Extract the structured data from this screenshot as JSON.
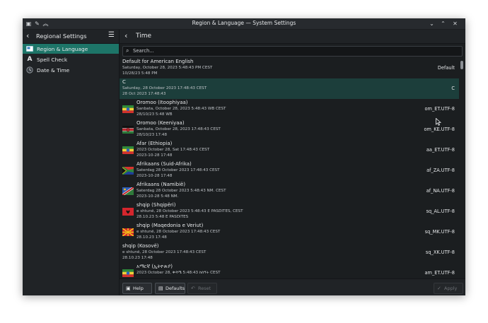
{
  "window": {
    "title": "Region & Language — System Settings"
  },
  "sidebar": {
    "header": "Regional Settings",
    "items": [
      {
        "label": "Region & Language",
        "icon": "region-icon",
        "active": true
      },
      {
        "label": "Spell Check",
        "icon": "spellcheck-icon",
        "active": false
      },
      {
        "label": "Date & Time",
        "icon": "clock-icon",
        "active": false
      }
    ]
  },
  "main": {
    "header": "Time",
    "search_placeholder": "Search...",
    "rows": [
      {
        "name": "Default for American English",
        "line2": "Saturday, October 28, 2023 5:48:43 PM CEST",
        "line3": "10/28/23 5:48 PM",
        "code": "Default",
        "flag": "none"
      },
      {
        "name": "C",
        "line2": "Saturday, 28 October 2023 17:48:43 CEST",
        "line3": "28 Oct 2023 17:48:43",
        "code": "C",
        "flag": "none",
        "selected": true
      },
      {
        "name": "Oromoo (Itoophiyaa)",
        "line2": "Sanbata, October 28, 2023 5:48:43 WB CEST",
        "line3": "28/10/23 5:48 WB",
        "code": "om_ET.UTF-8",
        "flag": "ethiopia"
      },
      {
        "name": "Oromoo (Keeniyaa)",
        "line2": "Sanbata, October 28, 2023 17:48:43 CEST",
        "line3": "28/10/23 17:48",
        "code": "om_KE.UTF-8",
        "flag": "kenya"
      },
      {
        "name": "Afar (Ethiopia)",
        "line2": "2023 October 28, Sat 17:48:43 CEST",
        "line3": "2023-10-28 17:48",
        "code": "aa_ET.UTF-8",
        "flag": "ethiopia"
      },
      {
        "name": "Afrikaans (Suid-Afrika)",
        "line2": "Saterdag 28 October 2023 17:48:43 CEST",
        "line3": "2023-10-28 17:48",
        "code": "af_ZA.UTF-8",
        "flag": "southafrica"
      },
      {
        "name": "Afrikaans (Namibië)",
        "line2": "Saterdag 28 October 2023 5:48:43 NM. CEST",
        "line3": "2023-10-28 5:48 NM.",
        "code": "af_NA.UTF-8",
        "flag": "namibia"
      },
      {
        "name": "shqip (Shqipëri)",
        "line2": "e shtunë, 28 October 2023 5:48:43 E PASDITES, CEST",
        "line3": "28.10.23 5:48 E PASDITES",
        "code": "sq_AL.UTF-8",
        "flag": "albania"
      },
      {
        "name": "shqip (Maqedonia e Veriut)",
        "line2": "e shtunë, 28 October 2023 17:48:43 CEST",
        "line3": "28.10.23 17:48",
        "code": "sq_MK.UTF-8",
        "flag": "macedonia"
      },
      {
        "name": "shqip (Kosovë)",
        "line2": "e shtunë, 28 October 2023 17:48:43 CEST",
        "line3": "28.10.23 17:48",
        "code": "sq_XK.UTF-8",
        "flag": "none"
      },
      {
        "name": "አማርኛ (ኢትዮጵያ)",
        "line2": "2023 October 28, ቅዳሜ 5:48:43 ከሰዓት CEST",
        "line3": "",
        "code": "am_ET.UTF-8",
        "flag": "ethiopia"
      }
    ]
  },
  "footer": {
    "help": "Help",
    "defaults": "Defaults",
    "reset": "Reset",
    "apply": "Apply"
  },
  "colors": {
    "accent": "#1d7568",
    "selected_row": "#1c3e3b",
    "background": "#1b1e20"
  }
}
